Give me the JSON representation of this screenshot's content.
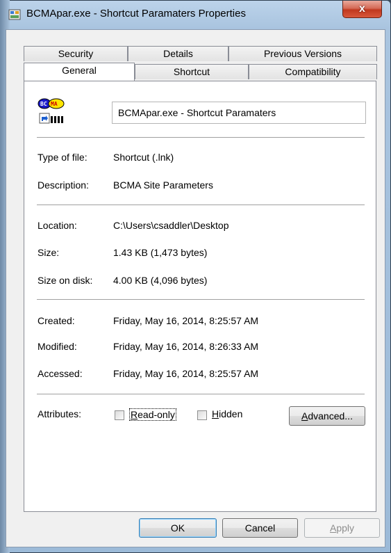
{
  "window": {
    "title": "BCMApar.exe - Shortcut Paramaters Properties",
    "close_glyph": "x"
  },
  "tabs": {
    "row_back": [
      "Security",
      "Details",
      "Previous Versions"
    ],
    "row_front": [
      "General",
      "Shortcut",
      "Compatibility"
    ],
    "active": "General"
  },
  "general": {
    "icon_text": "BCMA",
    "file_name": "BCMApar.exe - Shortcut Paramaters",
    "type_label": "Type of file:",
    "type_value": "Shortcut (.lnk)",
    "description_label": "Description:",
    "description_value": "BCMA Site Parameters",
    "location_label": "Location:",
    "location_value": "C:\\Users\\csaddler\\Desktop",
    "size_label": "Size:",
    "size_value": "1.43 KB (1,473 bytes)",
    "size_on_disk_label": "Size on disk:",
    "size_on_disk_value": "4.00 KB (4,096 bytes)",
    "created_label": "Created:",
    "created_value": "Friday, May 16, 2014, 8:25:57 AM",
    "modified_label": "Modified:",
    "modified_value": "Friday, May 16, 2014, 8:26:33 AM",
    "accessed_label": "Accessed:",
    "accessed_value": "Friday, May 16, 2014, 8:25:57 AM",
    "attributes_label": "Attributes:",
    "readonly_prefix": "R",
    "readonly_rest": "ead-only",
    "readonly_checked": false,
    "hidden_prefix": "H",
    "hidden_rest": "idden",
    "hidden_checked": false,
    "advanced_prefix": "A",
    "advanced_rest": "dvanced..."
  },
  "footer": {
    "ok": "OK",
    "cancel": "Cancel",
    "apply_prefix": "A",
    "apply_rest": "pply"
  },
  "colors": {
    "frame": "#a9c4df",
    "close_button": "#c0391f",
    "panel": "#ffffff",
    "dialog": "#f0f0f0"
  }
}
